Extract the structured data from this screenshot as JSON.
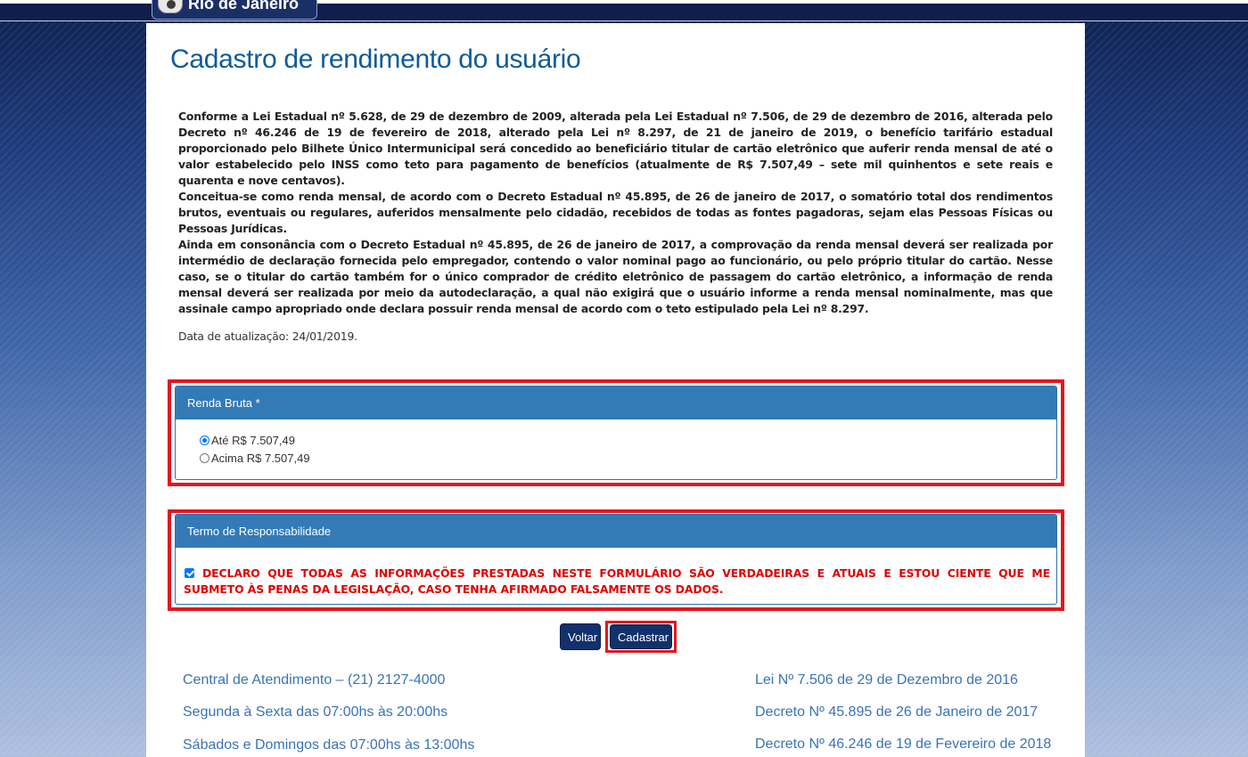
{
  "header": {
    "logo_text": "Rio de Janeiro"
  },
  "page": {
    "title": "Cadastro de rendimento do usuário",
    "paragraphs": [
      "Conforme a Lei Estadual nº 5.628, de 29 de dezembro de 2009, alterada pela Lei Estadual nº 7.506, de 29 de dezembro de 2016, alterada pelo Decreto nº 46.246 de 19 de fevereiro de 2018, alterado pela Lei nº 8.297, de 21 de janeiro de 2019, o benefício tarifário estadual proporcionado pelo Bilhete Único Intermunicipal será concedido ao beneficiário titular de cartão eletrônico que auferir renda mensal de até o valor estabelecido pelo INSS como teto para pagamento de benefícios (atualmente de R$ 7.507,49 – sete mil quinhentos e sete reais e quarenta e nove centavos).",
      "Conceitua-se como renda mensal, de acordo com o Decreto Estadual nº 45.895, de 26 de janeiro de 2017, o somatório total dos rendimentos brutos, eventuais ou regulares, auferidos mensalmente pelo cidadão, recebidos de todas as fontes pagadoras, sejam elas Pessoas Físicas ou Pessoas Jurídicas.",
      "Ainda em consonância com o Decreto Estadual nº 45.895, de 26 de janeiro de 2017, a comprovação da renda mensal deverá ser realizada por intermédio de declaração fornecida pelo empregador, contendo o valor nominal pago ao funcionário, ou pelo próprio titular do cartão. Nesse caso, se o titular do cartão também for o único comprador de crédito eletrônico de passagem do cartão eletrônico, a informação de renda mensal deverá ser realizada por meio da autodeclaração, a qual não exigirá que o usuário informe a renda mensal nominalmente, mas que assinale campo apropriado onde declara possuir renda mensal de acordo com o teto estipulado pela Lei nº 8.297."
    ],
    "update_date": "Data de atualização: 24/01/2019."
  },
  "renda_panel": {
    "title": "Renda Bruta *",
    "options": [
      "Até R$ 7.507,49",
      "Acima R$ 7.507,49"
    ],
    "selected": "Até R$ 7.507,49"
  },
  "termo_panel": {
    "title": "Termo de Responsabilidade",
    "declaration": "DECLARO QUE TODAS AS INFORMAÇÕES PRESTADAS NESTE FORMULÁRIO SÃO VERDADEIRAS E ATUAIS E ESTOU CIENTE QUE ME SUBMETO ÀS PENAS DA LEGISLAÇÃO, CASO TENHA AFIRMADO FALSAMENTE OS DADOS.",
    "checked": true
  },
  "buttons": {
    "back": "Voltar",
    "submit": "Cadastrar"
  },
  "footer": {
    "left": [
      "Central de Atendimento – (21) 2127-4000",
      "Segunda à Sexta das 07:00hs às 20:00hs",
      "Sábados e Domingos das 07:00hs às 13:00hs"
    ],
    "right": [
      "Lei Nº 7.506 de 29 de Dezembro de 2016",
      "Decreto Nº 45.895 de 26 de Janeiro de 2017",
      "Decreto Nº 46.246 de 19 de Fevereiro de 2018"
    ]
  },
  "colors": {
    "panel_header": "#337ab7",
    "highlight_border": "#e3161e",
    "title": "#0e5a9c",
    "declaration_text": "#e00000"
  }
}
